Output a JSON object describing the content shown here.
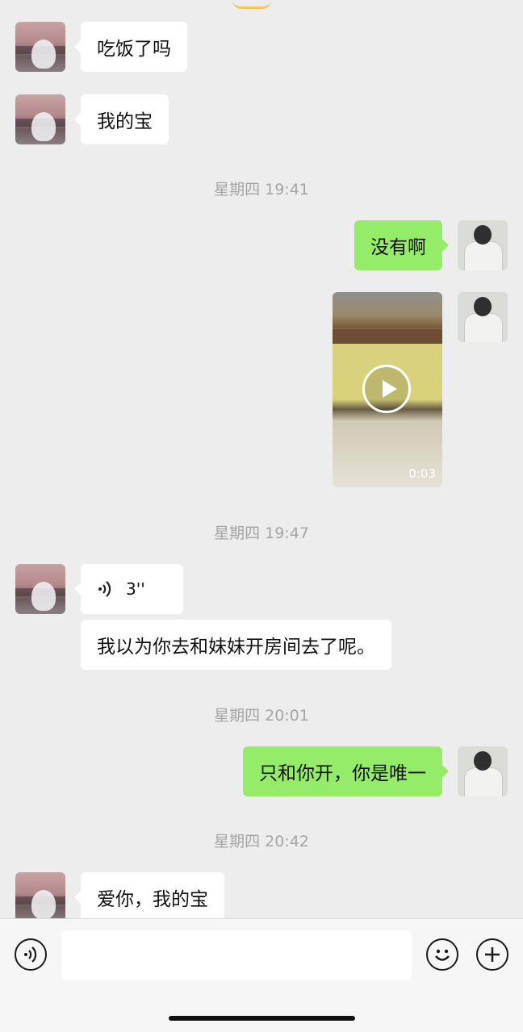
{
  "messages": [
    {
      "from": "her",
      "type": "text",
      "text": "吃饭了吗"
    },
    {
      "from": "her",
      "type": "text",
      "text": "我的宝"
    },
    {
      "type": "time",
      "text": "星期四 19:41"
    },
    {
      "from": "me",
      "type": "text",
      "text": "没有啊"
    },
    {
      "from": "me",
      "type": "video",
      "duration": "0:03"
    },
    {
      "type": "time",
      "text": "星期四 19:47"
    },
    {
      "from": "her",
      "type": "voice",
      "length": "3''"
    },
    {
      "from": "her",
      "type": "text",
      "text": "我以为你去和妹妹开房间去了呢。"
    },
    {
      "type": "time",
      "text": "星期四 20:01"
    },
    {
      "from": "me",
      "type": "text",
      "text": "只和你开，你是唯一"
    },
    {
      "type": "time",
      "text": "星期四 20:42"
    },
    {
      "from": "her",
      "type": "text",
      "text": "爱你，我的宝"
    }
  ],
  "input_bar": {
    "voice_icon": "voice-mode-icon",
    "input_value": "",
    "emoji_icon": "emoji-icon",
    "more_icon": "plus-icon"
  },
  "colors": {
    "background": "#ededed",
    "incoming_bubble": "#ffffff",
    "outgoing_bubble": "#95ec69",
    "timestamp": "#a5a5a5"
  }
}
